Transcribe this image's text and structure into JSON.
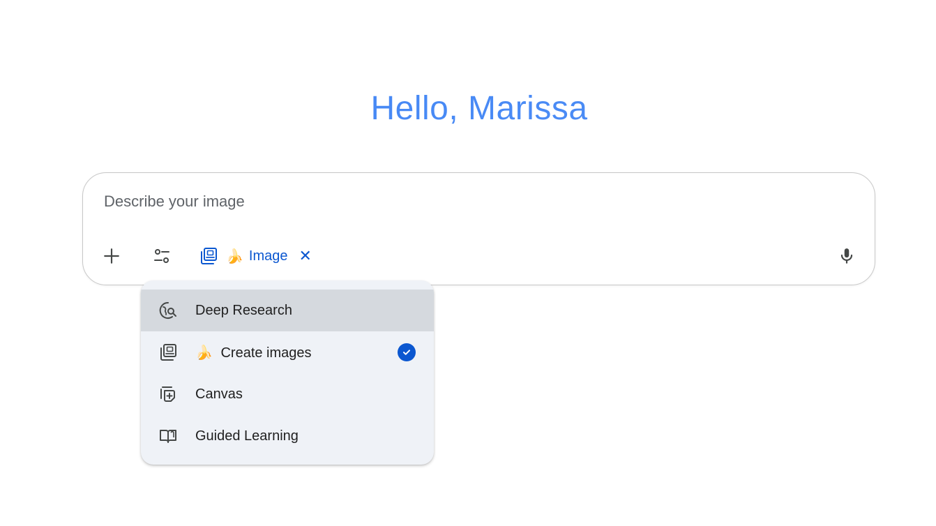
{
  "greeting": "Hello, Marissa",
  "prompt": {
    "placeholder": "Describe your image",
    "value": ""
  },
  "toolbar": {
    "add_icon": "plus-icon",
    "tools_icon": "tune-icon",
    "mic_icon": "mic-icon",
    "chip": {
      "icon": "image-stack-icon",
      "emoji": "🍌",
      "label": "Image",
      "close": "✕"
    }
  },
  "menu": {
    "items": [
      {
        "icon": "deep-research-icon",
        "label": "Deep Research",
        "emoji": "",
        "selected": false,
        "highlighted": true
      },
      {
        "icon": "image-stack-icon",
        "label": "Create images",
        "emoji": "🍌",
        "selected": true,
        "highlighted": false
      },
      {
        "icon": "canvas-icon",
        "label": "Canvas",
        "emoji": "",
        "selected": false,
        "highlighted": false
      },
      {
        "icon": "book-icon",
        "label": "Guided Learning",
        "emoji": "",
        "selected": false,
        "highlighted": false
      }
    ]
  },
  "colors": {
    "accent": "#0b57d0",
    "greeting_start": "#4285f4",
    "menu_bg": "#eff2f7",
    "menu_highlight": "#d5d9de"
  }
}
